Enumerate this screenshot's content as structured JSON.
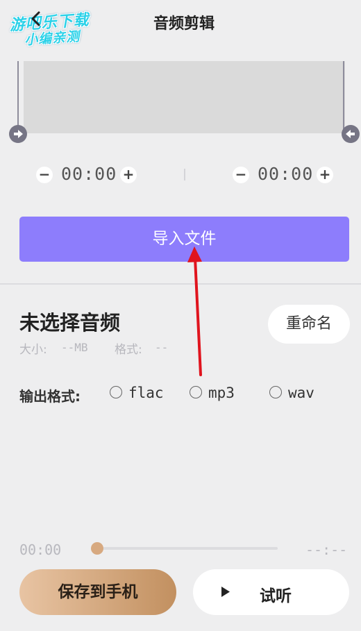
{
  "watermark": {
    "line1": "游吧乐下载",
    "line2": "小编亲测"
  },
  "header": {
    "title": "音频剪辑"
  },
  "waveform": {
    "start_handle_icon": "arrow-right-icon",
    "end_handle_icon": "arrow-left-icon",
    "start_time": "00:00",
    "end_time": "00:00",
    "minus_symbol": "−",
    "plus_symbol": "+"
  },
  "import": {
    "label": "导入文件"
  },
  "file": {
    "title": "未选择音频",
    "size_label": "大小:",
    "size_value": "--MB",
    "format_label": "格式:",
    "format_value": "--",
    "rename_label": "重命名"
  },
  "output": {
    "label": "输出格式:",
    "options": [
      {
        "label": "flac",
        "selected": false
      },
      {
        "label": "mp3",
        "selected": false
      },
      {
        "label": "wav",
        "selected": false
      }
    ]
  },
  "player": {
    "current_time": "00:00",
    "total_time": "--:--",
    "progress": 0,
    "save_label": "保存到手机",
    "preview_label": "试听",
    "play_icon": "play-icon"
  },
  "colors": {
    "accent": "#8d7dfc",
    "save_gradient_start": "#e8c4a3",
    "save_gradient_end": "#c29060",
    "annotation": "#e0141e"
  }
}
